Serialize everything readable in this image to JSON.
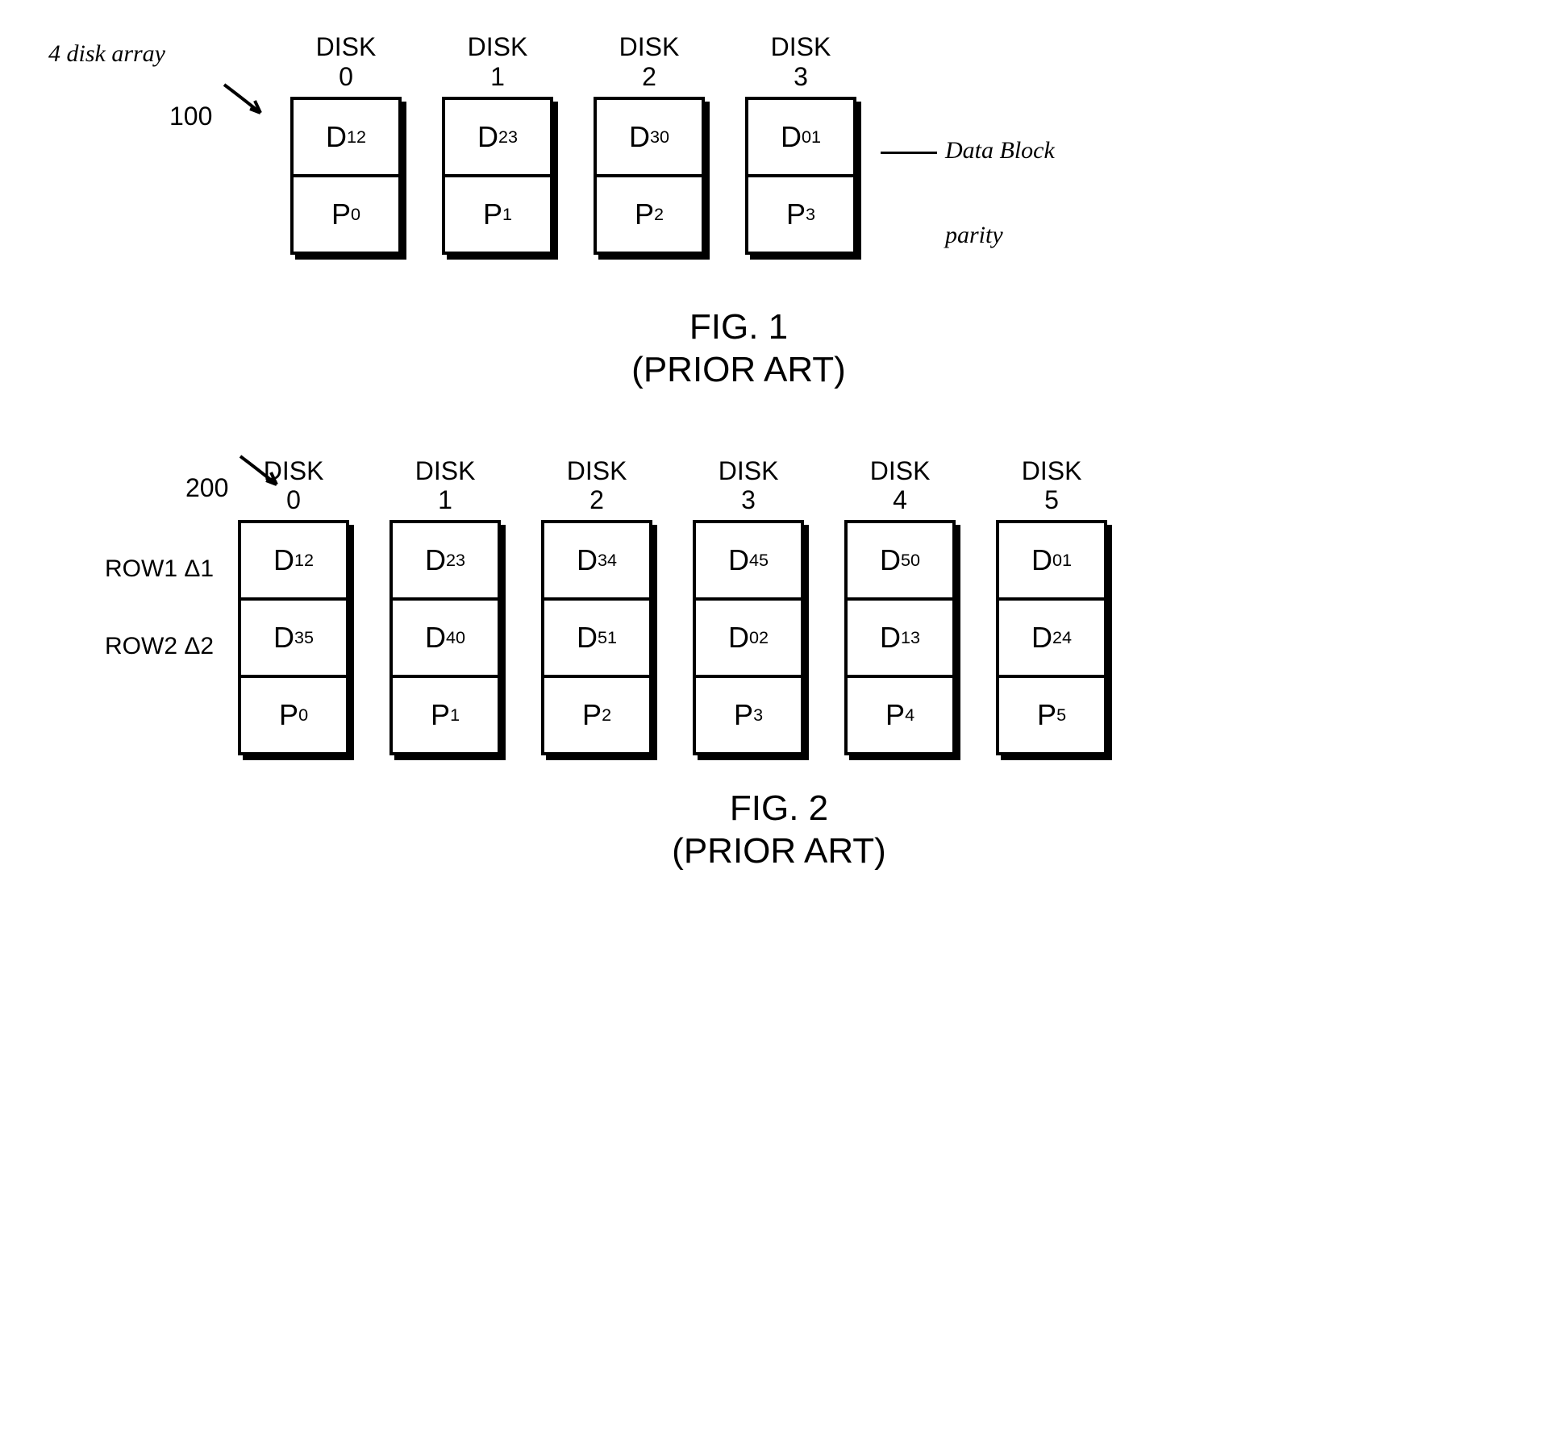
{
  "fig1": {
    "ref": "100",
    "annot_left": "4 disk array",
    "annot_right_top": "Data Block",
    "annot_right_bottom": "parity",
    "caption_line1": "FIG. 1",
    "caption_line2": "(PRIOR ART)",
    "disks": [
      {
        "header_top": "DISK",
        "header_bot": "0",
        "cells": [
          "D<sub>12</sub>",
          "P<sub>0</sub>"
        ]
      },
      {
        "header_top": "DISK",
        "header_bot": "1",
        "cells": [
          "D<sub>23</sub>",
          "P<sub>1</sub>"
        ]
      },
      {
        "header_top": "DISK",
        "header_bot": "2",
        "cells": [
          "D<sub>30</sub>",
          "P<sub>2</sub>"
        ]
      },
      {
        "header_top": "DISK",
        "header_bot": "3",
        "cells": [
          "D<sub>01</sub>",
          "P<sub>3</sub>"
        ]
      }
    ]
  },
  "fig2": {
    "ref": "200",
    "row_labels": [
      "ROW1 Δ1",
      "ROW2 Δ2"
    ],
    "caption_line1": "FIG. 2",
    "caption_line2": "(PRIOR ART)",
    "disks": [
      {
        "header_top": "DISK",
        "header_bot": "0",
        "cells": [
          "D<sub>12</sub>",
          "D<sub>35</sub>",
          "P<sub>0</sub>"
        ]
      },
      {
        "header_top": "DISK",
        "header_bot": "1",
        "cells": [
          "D<sub>23</sub>",
          "D<sub>40</sub>",
          "P<sub>1</sub>"
        ]
      },
      {
        "header_top": "DISK",
        "header_bot": "2",
        "cells": [
          "D<sub>34</sub>",
          "D<sub>51</sub>",
          "P<sub>2</sub>"
        ]
      },
      {
        "header_top": "DISK",
        "header_bot": "3",
        "cells": [
          "D<sub>45</sub>",
          "D<sub>02</sub>",
          "P<sub>3</sub>"
        ]
      },
      {
        "header_top": "DISK",
        "header_bot": "4",
        "cells": [
          "D<sub>50</sub>",
          "D<sub>13</sub>",
          "P<sub>4</sub>"
        ]
      },
      {
        "header_top": "DISK",
        "header_bot": "5",
        "cells": [
          "D<sub>01</sub>",
          "D<sub>24</sub>",
          "P<sub>5</sub>"
        ]
      }
    ]
  }
}
